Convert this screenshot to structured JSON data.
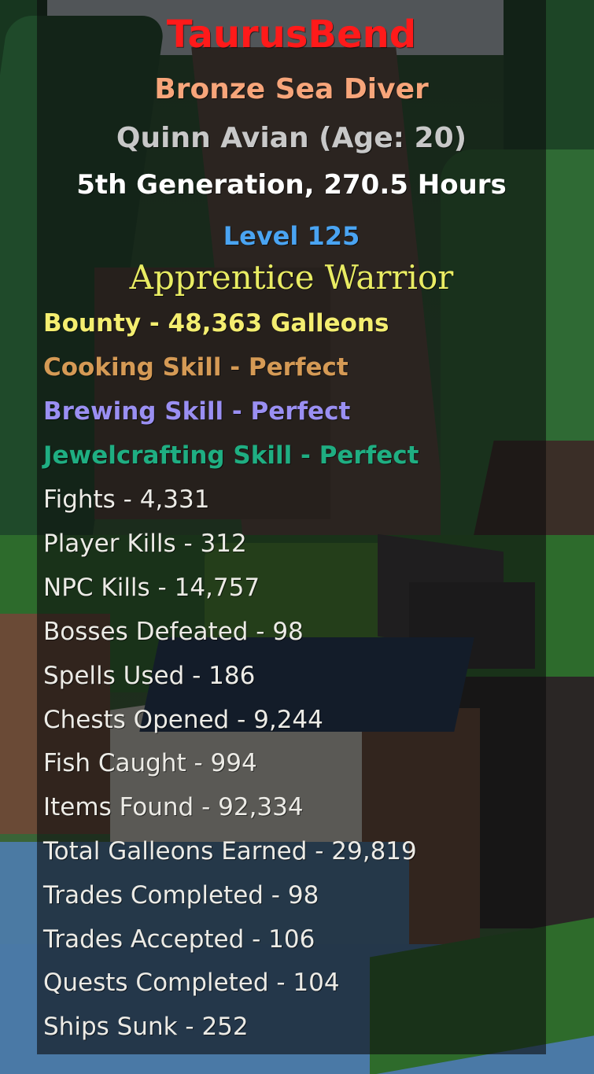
{
  "colors": {
    "name": "#ff1a1a",
    "title": "#f7a57a",
    "character": "#c8c8c8",
    "generation": "#ffffff",
    "level": "#4aa4f2",
    "rank": "#e9ec63",
    "bounty": "#f4ee70",
    "cooking": "#d59a55",
    "brewing": "#9a8ff2",
    "jewelcrafting": "#1fae82",
    "stats": "#ecebe6",
    "panel": "#0c0c0e"
  },
  "profile": {
    "name": "TaurusBend",
    "title": "Bronze Sea Diver",
    "character": "Quinn Avian (Age: 20)",
    "generation": "5th Generation, 270.5 Hours",
    "level": "Level 125",
    "rank": "Apprentice Warrior"
  },
  "bounty": "Bounty - 48,363 Galleons",
  "skills": [
    {
      "label": "Cooking Skill - ",
      "value": "Perfect"
    },
    {
      "label": "Brewing Skill - ",
      "value": "Perfect"
    },
    {
      "label": "Jewelcrafting Skill - ",
      "value": "Perfect"
    }
  ],
  "stats": [
    "Fights - 4,331",
    "Player Kills - 312",
    "NPC Kills - 14,757",
    "Bosses Defeated - 98",
    "Spells Used - 186",
    "Chests Opened - 9,244",
    "Fish Caught - 994",
    "Items Found - 92,334",
    "Total Galleons Earned - 29,819",
    "Trades Completed - 98",
    "Trades Accepted - 106",
    "Quests Completed - 104",
    "Ships Sunk - 252"
  ]
}
